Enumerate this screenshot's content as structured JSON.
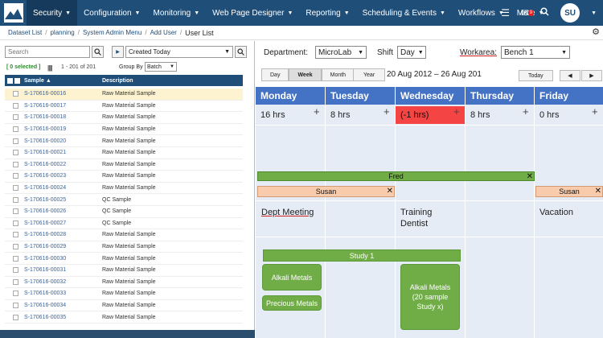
{
  "nav": {
    "items": [
      {
        "label": "Security",
        "active": true
      },
      {
        "label": "Configuration"
      },
      {
        "label": "Monitoring"
      },
      {
        "label": "Web Page Designer"
      },
      {
        "label": "Reporting"
      },
      {
        "label": "Scheduling & Events"
      },
      {
        "label": "Workflows"
      },
      {
        "label": "More"
      }
    ],
    "notification_count": "9",
    "user_initials": "SU",
    "colors": {
      "bar": "#1f4e79"
    }
  },
  "breadcrumb": {
    "links": [
      "Dataset List",
      "planning",
      "System Admin Menu",
      "Add User"
    ],
    "current": "User List"
  },
  "left": {
    "search_placeholder": "Search",
    "filter_value": "Created Today",
    "selected_text": "[ 0 selected ]",
    "range_text": "1 - 201 of 201",
    "group_by_label": "Group By",
    "group_by_value": "Batch",
    "columns": {
      "sample": "Sample ▲",
      "description": "Description"
    },
    "rows": [
      {
        "sample": "S-170616-00016",
        "description": "Raw Material Sample"
      },
      {
        "sample": "S-170616-00017",
        "description": "Raw Material Sample"
      },
      {
        "sample": "S-170616-00018",
        "description": "Raw Material Sample"
      },
      {
        "sample": "S-170616-00019",
        "description": "Raw Material Sample"
      },
      {
        "sample": "S-170616-00020",
        "description": "Raw Material Sample"
      },
      {
        "sample": "S-170616-00021",
        "description": "Raw Material Sample"
      },
      {
        "sample": "S-170616-00022",
        "description": "Raw Material Sample"
      },
      {
        "sample": "S-170616-00023",
        "description": "Raw Material Sample"
      },
      {
        "sample": "S-170616-00024",
        "description": "Raw Material Sample"
      },
      {
        "sample": "S-170616-00025",
        "description": "QC Sample"
      },
      {
        "sample": "S-170616-00026",
        "description": "QC Sample"
      },
      {
        "sample": "S-170616-00027",
        "description": "QC Sample"
      },
      {
        "sample": "S-170616-00028",
        "description": "Raw Material Sample"
      },
      {
        "sample": "S-170616-00029",
        "description": "Raw Material Sample"
      },
      {
        "sample": "S-170616-00030",
        "description": "Raw Material Sample"
      },
      {
        "sample": "S-170616-00031",
        "description": "Raw Material Sample"
      },
      {
        "sample": "S-170616-00032",
        "description": "Raw Material Sample"
      },
      {
        "sample": "S-170616-00033",
        "description": "Raw Material Sample"
      },
      {
        "sample": "S-170616-00034",
        "description": "Raw Material Sample"
      },
      {
        "sample": "S-170616-00035",
        "description": "Raw Material Sample"
      }
    ]
  },
  "filters": {
    "department_label": "Department:",
    "department_value": "MicroLab",
    "shift_label": "Shift",
    "shift_value": "Day",
    "workarea_label": "Workarea:",
    "workarea_value": "Bench 1"
  },
  "calendar": {
    "views": [
      "Day",
      "Week",
      "Month"
    ],
    "year_label": "Year",
    "date_range": "20 Aug 2012 – 26 Aug 201",
    "today_label": "Today",
    "prev": "◀",
    "next": "▶",
    "days": [
      {
        "name": "Monday",
        "hours": "16 hrs"
      },
      {
        "name": "Tuesday",
        "hours": "8 hrs"
      },
      {
        "name": "Wednesday",
        "hours": "(-1  hrs)",
        "overbooked": true
      },
      {
        "name": "Thursday",
        "hours": "8 hrs"
      },
      {
        "name": "Friday",
        "hours": "0 hrs"
      }
    ],
    "fred_label": "Fred",
    "susan_label": "Susan",
    "events": {
      "dept_meeting": "Dept Meeting",
      "training_dentist_1": "Training",
      "training_dentist_2": "Dentist",
      "vacation": "Vacation"
    },
    "tasks": {
      "study1": "Study 1",
      "alkali": "Alkali Metals",
      "precious": "Precious Metals",
      "alkali_study_1": "Alkali Metals",
      "alkali_study_2": "(20 sample",
      "alkali_study_3": "Study x)"
    },
    "colors": {
      "header": "#4472c4",
      "green": "#70ad47",
      "salmon": "#f8cbad",
      "red": "#f44444"
    }
  }
}
